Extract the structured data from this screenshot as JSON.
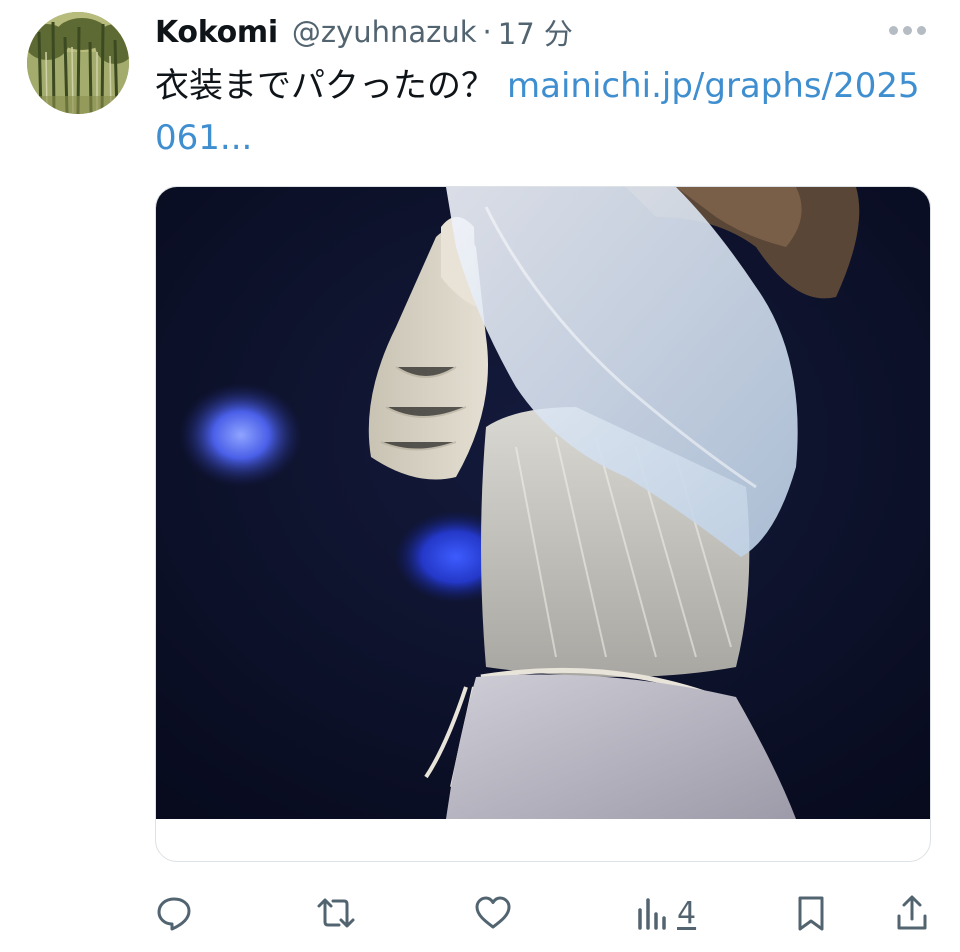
{
  "tweet": {
    "display_name": "Kokomi",
    "handle": "@zyuhnazuk",
    "separator": "·",
    "time": "17 分",
    "text": "衣装までパクったの？",
    "link": "mainichi.jp/graphs/2025061...",
    "avatar_icon": "bamboo-forest-avatar",
    "more_icon": "more-dots-icon",
    "media_alt": "figure-skater-photo"
  },
  "actions": {
    "reply_icon": "reply-icon",
    "retweet_icon": "retweet-icon",
    "like_icon": "heart-icon",
    "views_icon": "views-chart-icon",
    "views_count": "4",
    "bookmark_icon": "bookmark-icon",
    "share_icon": "share-icon"
  },
  "colors": {
    "link": "#3f8fd0",
    "secondary_text": "#536471",
    "primary_text": "#0f1419",
    "photo_background": "#0b0f2a"
  }
}
